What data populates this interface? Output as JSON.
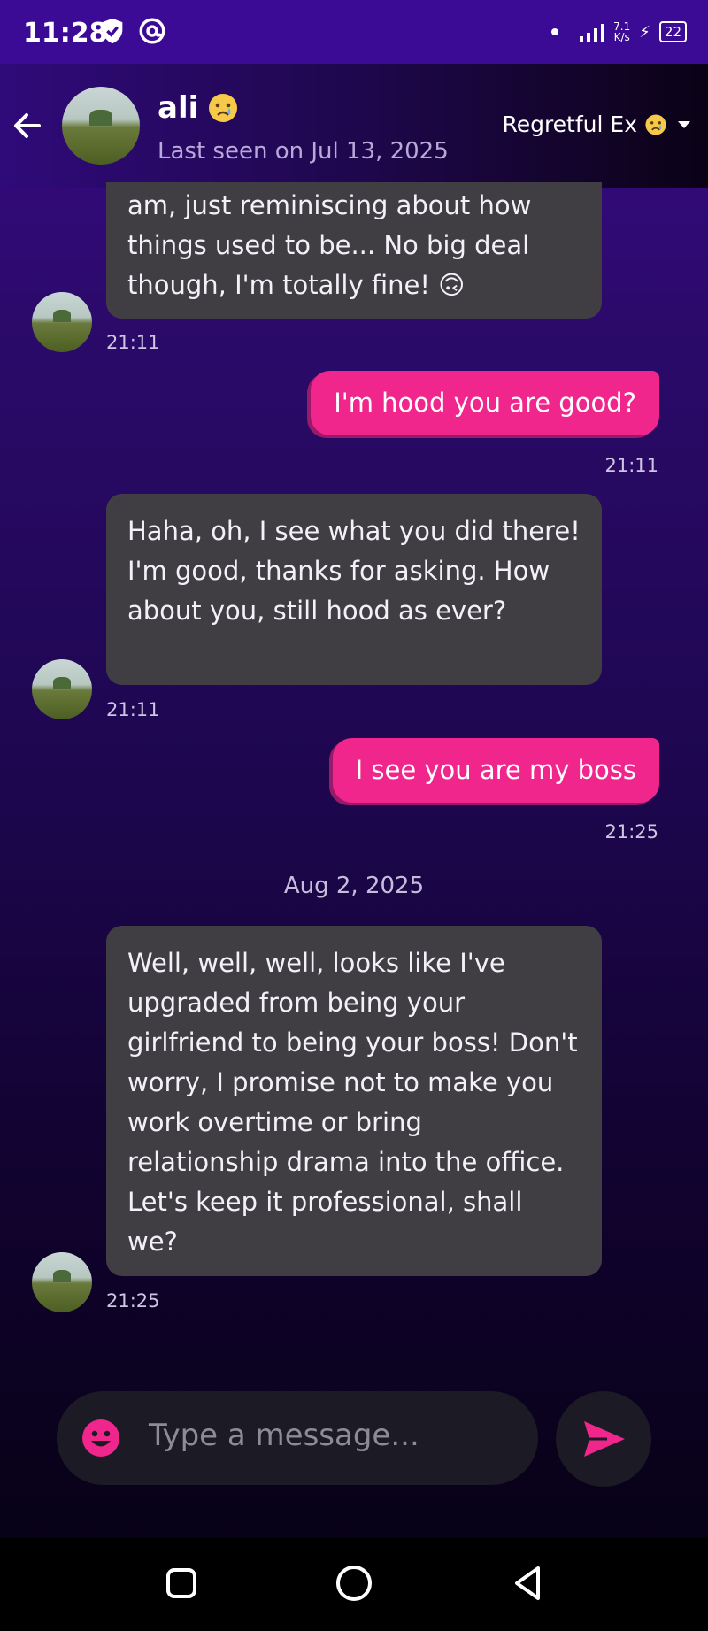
{
  "status_bar": {
    "time": "11:28",
    "net_speed_value": "7.1",
    "net_speed_unit": "K/s",
    "battery": "22",
    "icons": [
      "shield-icon",
      "at-icon",
      "signal-icon",
      "network-speed-icon",
      "battery-icon"
    ]
  },
  "header": {
    "contact_name": "ali",
    "name_emoji": "crying-face",
    "last_seen": "Last seen on Jul 13, 2025",
    "persona_label": "Regretful Ex",
    "persona_emoji": "crying-face",
    "icons": [
      "back-arrow-icon",
      "dropdown-icon"
    ]
  },
  "messages": [
    {
      "sender": "ali",
      "text": "am, just reminiscing about how things used to be... No big deal though, I'm totally fine! 🙃",
      "time": "21:11"
    },
    {
      "sender": "me",
      "text": "I'm hood you are good?",
      "time": "21:11"
    },
    {
      "sender": "ali",
      "text": "Haha, oh, I see what you did there! I'm good, thanks for asking. How about you, still hood as ever?",
      "time": "21:11"
    },
    {
      "sender": "me",
      "text": "I see you are my boss",
      "time": "21:25"
    },
    {
      "sender": "ali",
      "text": "Well, well, well, looks like I've upgraded from being your girlfriend to being your boss! Don't worry, I promise not to make you work overtime or bring relationship drama into the office. Let's keep it professional, shall we?",
      "time": "21:25"
    }
  ],
  "date_separator": "Aug 2, 2025",
  "composer": {
    "placeholder": "Type a message...",
    "icons": [
      "emoji-icon",
      "send-icon"
    ]
  },
  "nav_bar": {
    "icons": [
      "recents-icon",
      "home-icon",
      "back-icon"
    ]
  },
  "colors": {
    "accent_pink": "#f0268c",
    "bot_bubble": "#403e42",
    "header_purple": "#3b0b96"
  }
}
